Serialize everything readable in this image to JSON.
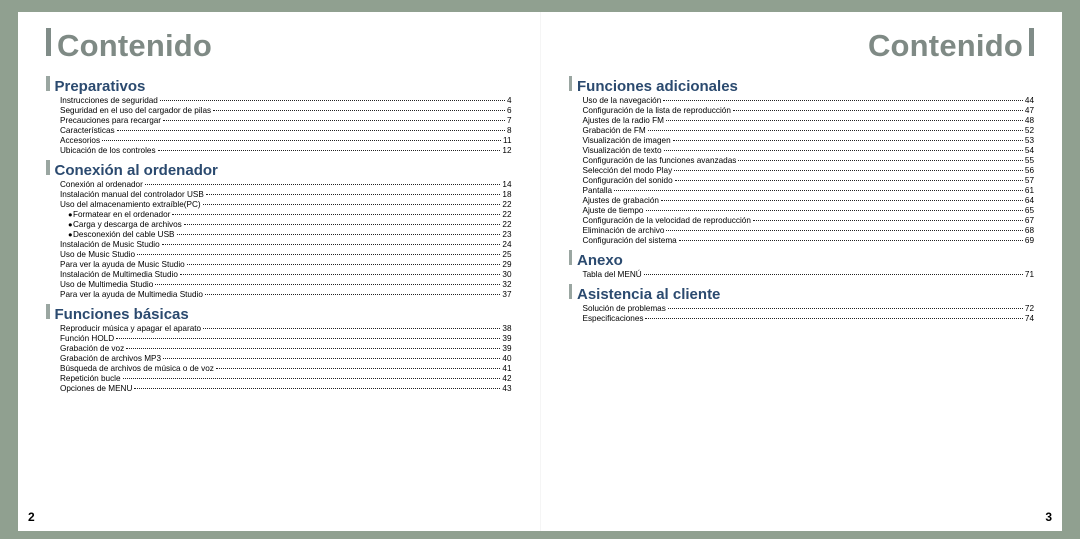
{
  "page_title_left": "Contenido",
  "page_title_right": "Contenido",
  "page_number_left": "2",
  "page_number_right": "3",
  "left": {
    "sections": [
      {
        "title": "Preparativos",
        "items": [
          {
            "label": "Instrucciones de seguridad",
            "page": "4"
          },
          {
            "label": "Seguridad en el uso del cargador de pilas",
            "page": "6"
          },
          {
            "label": "Precauciones para recargar",
            "page": "7"
          },
          {
            "label": "Características",
            "page": "8"
          },
          {
            "label": "Accesorios",
            "page": "11"
          },
          {
            "label": "Ubicación de los controles",
            "page": "12"
          }
        ]
      },
      {
        "title": "Conexión al ordenador",
        "items": [
          {
            "label": "Conexión al ordenador",
            "page": "14"
          },
          {
            "label": "Instalación manual del controlador USB",
            "page": "18"
          },
          {
            "label": "Uso del almacenamiento extraíble(PC)",
            "page": "22"
          },
          {
            "label": "Formatear en el ordenador",
            "page": "22",
            "indent": true,
            "bullet": true
          },
          {
            "label": "Carga y descarga de archivos",
            "page": "22",
            "indent": true,
            "bullet": true
          },
          {
            "label": "Desconexión del cable USB",
            "page": "23",
            "indent": true,
            "bullet": true
          },
          {
            "label": "Instalación de Music Studio",
            "page": "24"
          },
          {
            "label": "Uso de Music Studio",
            "page": "25"
          },
          {
            "label": "Para ver la ayuda de Music Studio",
            "page": "29"
          },
          {
            "label": "Instalación de Multimedia Studio",
            "page": "30"
          },
          {
            "label": "Uso de Multimedia Studio",
            "page": "32"
          },
          {
            "label": "Para ver la ayuda de Multimedia Studio",
            "page": "37"
          }
        ]
      },
      {
        "title": "Funciones básicas",
        "items": [
          {
            "label": "Reproducir música y apagar el aparato",
            "page": "38"
          },
          {
            "label": "Función HOLD",
            "page": "39"
          },
          {
            "label": "Grabación de voz",
            "page": "39"
          },
          {
            "label": "Grabación de archivos MP3",
            "page": "40"
          },
          {
            "label": "Búsqueda de archivos de música o de voz",
            "page": "41"
          },
          {
            "label": "Repetición bucle",
            "page": "42"
          },
          {
            "label": "Opciones de MENU",
            "page": "43"
          }
        ]
      }
    ]
  },
  "right": {
    "sections": [
      {
        "title": "Funciones adicionales",
        "items": [
          {
            "label": "Uso de la navegación",
            "page": "44"
          },
          {
            "label": "Configuración de la lista de reproducción",
            "page": "47"
          },
          {
            "label": "Ajustes de la radio FM",
            "page": "48"
          },
          {
            "label": "Grabación de FM",
            "page": "52"
          },
          {
            "label": "Visualización de imagen",
            "page": "53"
          },
          {
            "label": "Visualización de texto",
            "page": "54"
          },
          {
            "label": "Configuración de las funciones avanzadas",
            "page": "55"
          },
          {
            "label": "Selección del modo Play",
            "page": "56"
          },
          {
            "label": "Configuración del sonido",
            "page": "57"
          },
          {
            "label": "Pantalla",
            "page": "61"
          },
          {
            "label": "Ajustes de grabación",
            "page": "64"
          },
          {
            "label": "Ajuste de tiempo",
            "page": "65"
          },
          {
            "label": "Configuración de la velocidad de reproducción",
            "page": "67"
          },
          {
            "label": "Eliminación de archivo",
            "page": "68"
          },
          {
            "label": "Configuración del sistema",
            "page": "69"
          }
        ]
      },
      {
        "title": "Anexo",
        "items": [
          {
            "label": "Tabla del MENÚ",
            "page": "71"
          }
        ]
      },
      {
        "title": "Asistencia al cliente",
        "items": [
          {
            "label": "Solución de problemas",
            "page": "72"
          },
          {
            "label": "Especificaciones",
            "page": "74"
          }
        ]
      }
    ]
  }
}
